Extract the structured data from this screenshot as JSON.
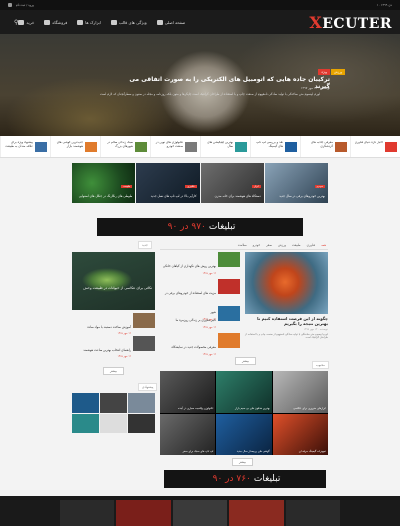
{
  "topbar": {
    "left_text": "۱۰ دی ۱۳۹۹",
    "right_text": "ورود / ثبت نام"
  },
  "header": {
    "logo_x": "X",
    "logo_rest": "ECUTER",
    "nav": [
      "صفحه اصلی",
      "ویژگی های قالب",
      "ابزارک ها",
      "فروشگاه",
      "خرید"
    ]
  },
  "hero": {
    "badge1": "ویژه",
    "badge2": "ورزش",
    "title": "ترکیبان جاده هایی که اتومبیل های الکتریکی را به صورت اتفاقی می گیرند",
    "meta": "نویسنده · ۱۲ مهر ۱۳۹۷",
    "excerpt": "لورم ایپسوم متن ساختگی با تولید سادگی نامفهوم از صنعت چاپ و با استفاده از طراحان گرافیک است چاپگرها و متون بلکه روزنامه و مجله در ستون و سطرآنچنان که لازم است"
  },
  "ticker": [
    "پیشنهاد ویژه برای علاقه مندان به طبیعت",
    "جدیدترین گوشی های هوشمند بازار",
    "سبک زندگی سالم در شهرهای بزرگ",
    "تکنولوژی های نوین در صنعت خودرو",
    "بهترین اپلیکیشن های سال",
    "نقد و بررسی لپ تاپ های گیمینگ",
    "معرفی جاذبه های گردشگری",
    "اخبار تازه دنیای فناوری"
  ],
  "featured": [
    {
      "badge": "طبیعت",
      "caption": "طوطی های رنگارنگ در جنگل های استوایی"
    },
    {
      "badge": "فناوری",
      "caption": "کارآیی بالا در لپ تاپ های نسل جدید"
    },
    {
      "badge": "ابزار",
      "caption": "دستگاه های هوشمند برای خانه مدرن"
    },
    {
      "badge": "خودرو",
      "caption": "بهترین خودروهای برقی در سال جدید"
    }
  ],
  "ads": {
    "ad1_label": "تبلیغات",
    "ad1_size": "۹۷۰ در ۹۰",
    "ad2_label": "تبلیغات",
    "ad2_size": "۷۶۰ در ۹۰"
  },
  "tabs": [
    "همه",
    "فناوری",
    "طبیعت",
    "ورزش",
    "سفر",
    "خودرو",
    "سلامت"
  ],
  "section_label_1": "جدید",
  "section_label_2": "محبوب",
  "section_label_3": "پیشنهادی",
  "big_post": {
    "title": "چگونه از این فرصت استفاده کنیم تا بهترین نتیجه را بگیریم",
    "meta": "نویسنده · ۱۲ مهر ۱۳۹۷",
    "text": "لورم ایپسوم متن ساختگی با تولید سادگی نامفهوم از صنعت چاپ و با استفاده از طراحان گرافیک است"
  },
  "list_posts": [
    {
      "title": "بهترین روش های نگهداری از گیاهان خانگی",
      "meta": "۱۲ مهر ۱۳۹۷"
    },
    {
      "title": "مزیت های استفاده از خودروهای برقی در شهر",
      "meta": "۱۲ مهر ۱۳۹۷"
    },
    {
      "title": "تاثیر فناوری بر زندگی روزمره ما",
      "meta": "۱۲ مهر ۱۳۹۷"
    },
    {
      "title": "معرفی محصولات جدید در نمایشگاه",
      "meta": "۱۲ مهر ۱۳۹۷"
    }
  ],
  "lizard_caption": "نکاتی برای عکاسی از حیوانات در طبیعت وحش",
  "left_list": [
    {
      "title": "آموزش ساخت دستبند با مواد ساده",
      "meta": "۱۲ مهر ۱۳۹۷"
    },
    {
      "title": "راهنمای انتخاب بهترین ساعت هوشمند",
      "meta": "۱۲ مهر ۱۳۹۷"
    }
  ],
  "more_label": "بیشتر",
  "mosaic": [
    "تکنولوژی واقعیت مجازی در آینده",
    "بهترین هدفون های بی سیم بازار",
    "ابزارهای ضروری برای عکاسی",
    "لپ تاپ های سبک برای سفر",
    "گوشی های پرچمدار سال جدید",
    "تجهیزات گیمینگ حرفه ای"
  ]
}
